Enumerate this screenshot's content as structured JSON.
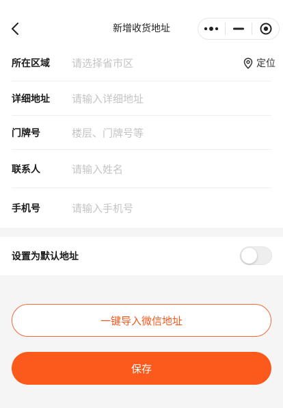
{
  "header": {
    "title": "新增收货地址",
    "back_icon": "chevron-left-icon",
    "capsule_icons": [
      "more-dots-icon",
      "minimize-icon",
      "close-target-icon"
    ]
  },
  "form": {
    "region": {
      "label": "所在区域",
      "placeholder": "请选择省市区",
      "locate_label": "定位",
      "locate_icon": "location-pin-icon"
    },
    "detail": {
      "label": "详细地址",
      "placeholder": "请输入详细地址"
    },
    "door": {
      "label": "门牌号",
      "placeholder": "楼层、门牌号等"
    },
    "contact": {
      "label": "联系人",
      "placeholder": "请输入姓名"
    },
    "phone": {
      "label": "手机号",
      "placeholder": "请输入手机号"
    }
  },
  "default_address": {
    "label": "设置为默认地址",
    "enabled": false
  },
  "actions": {
    "import_label": "一键导入微信地址",
    "save_label": "保存"
  },
  "colors": {
    "accent": "#fb5a1c",
    "outline": "#f0683a",
    "placeholder": "#c4c4c4",
    "background": "#f5f5f5"
  }
}
